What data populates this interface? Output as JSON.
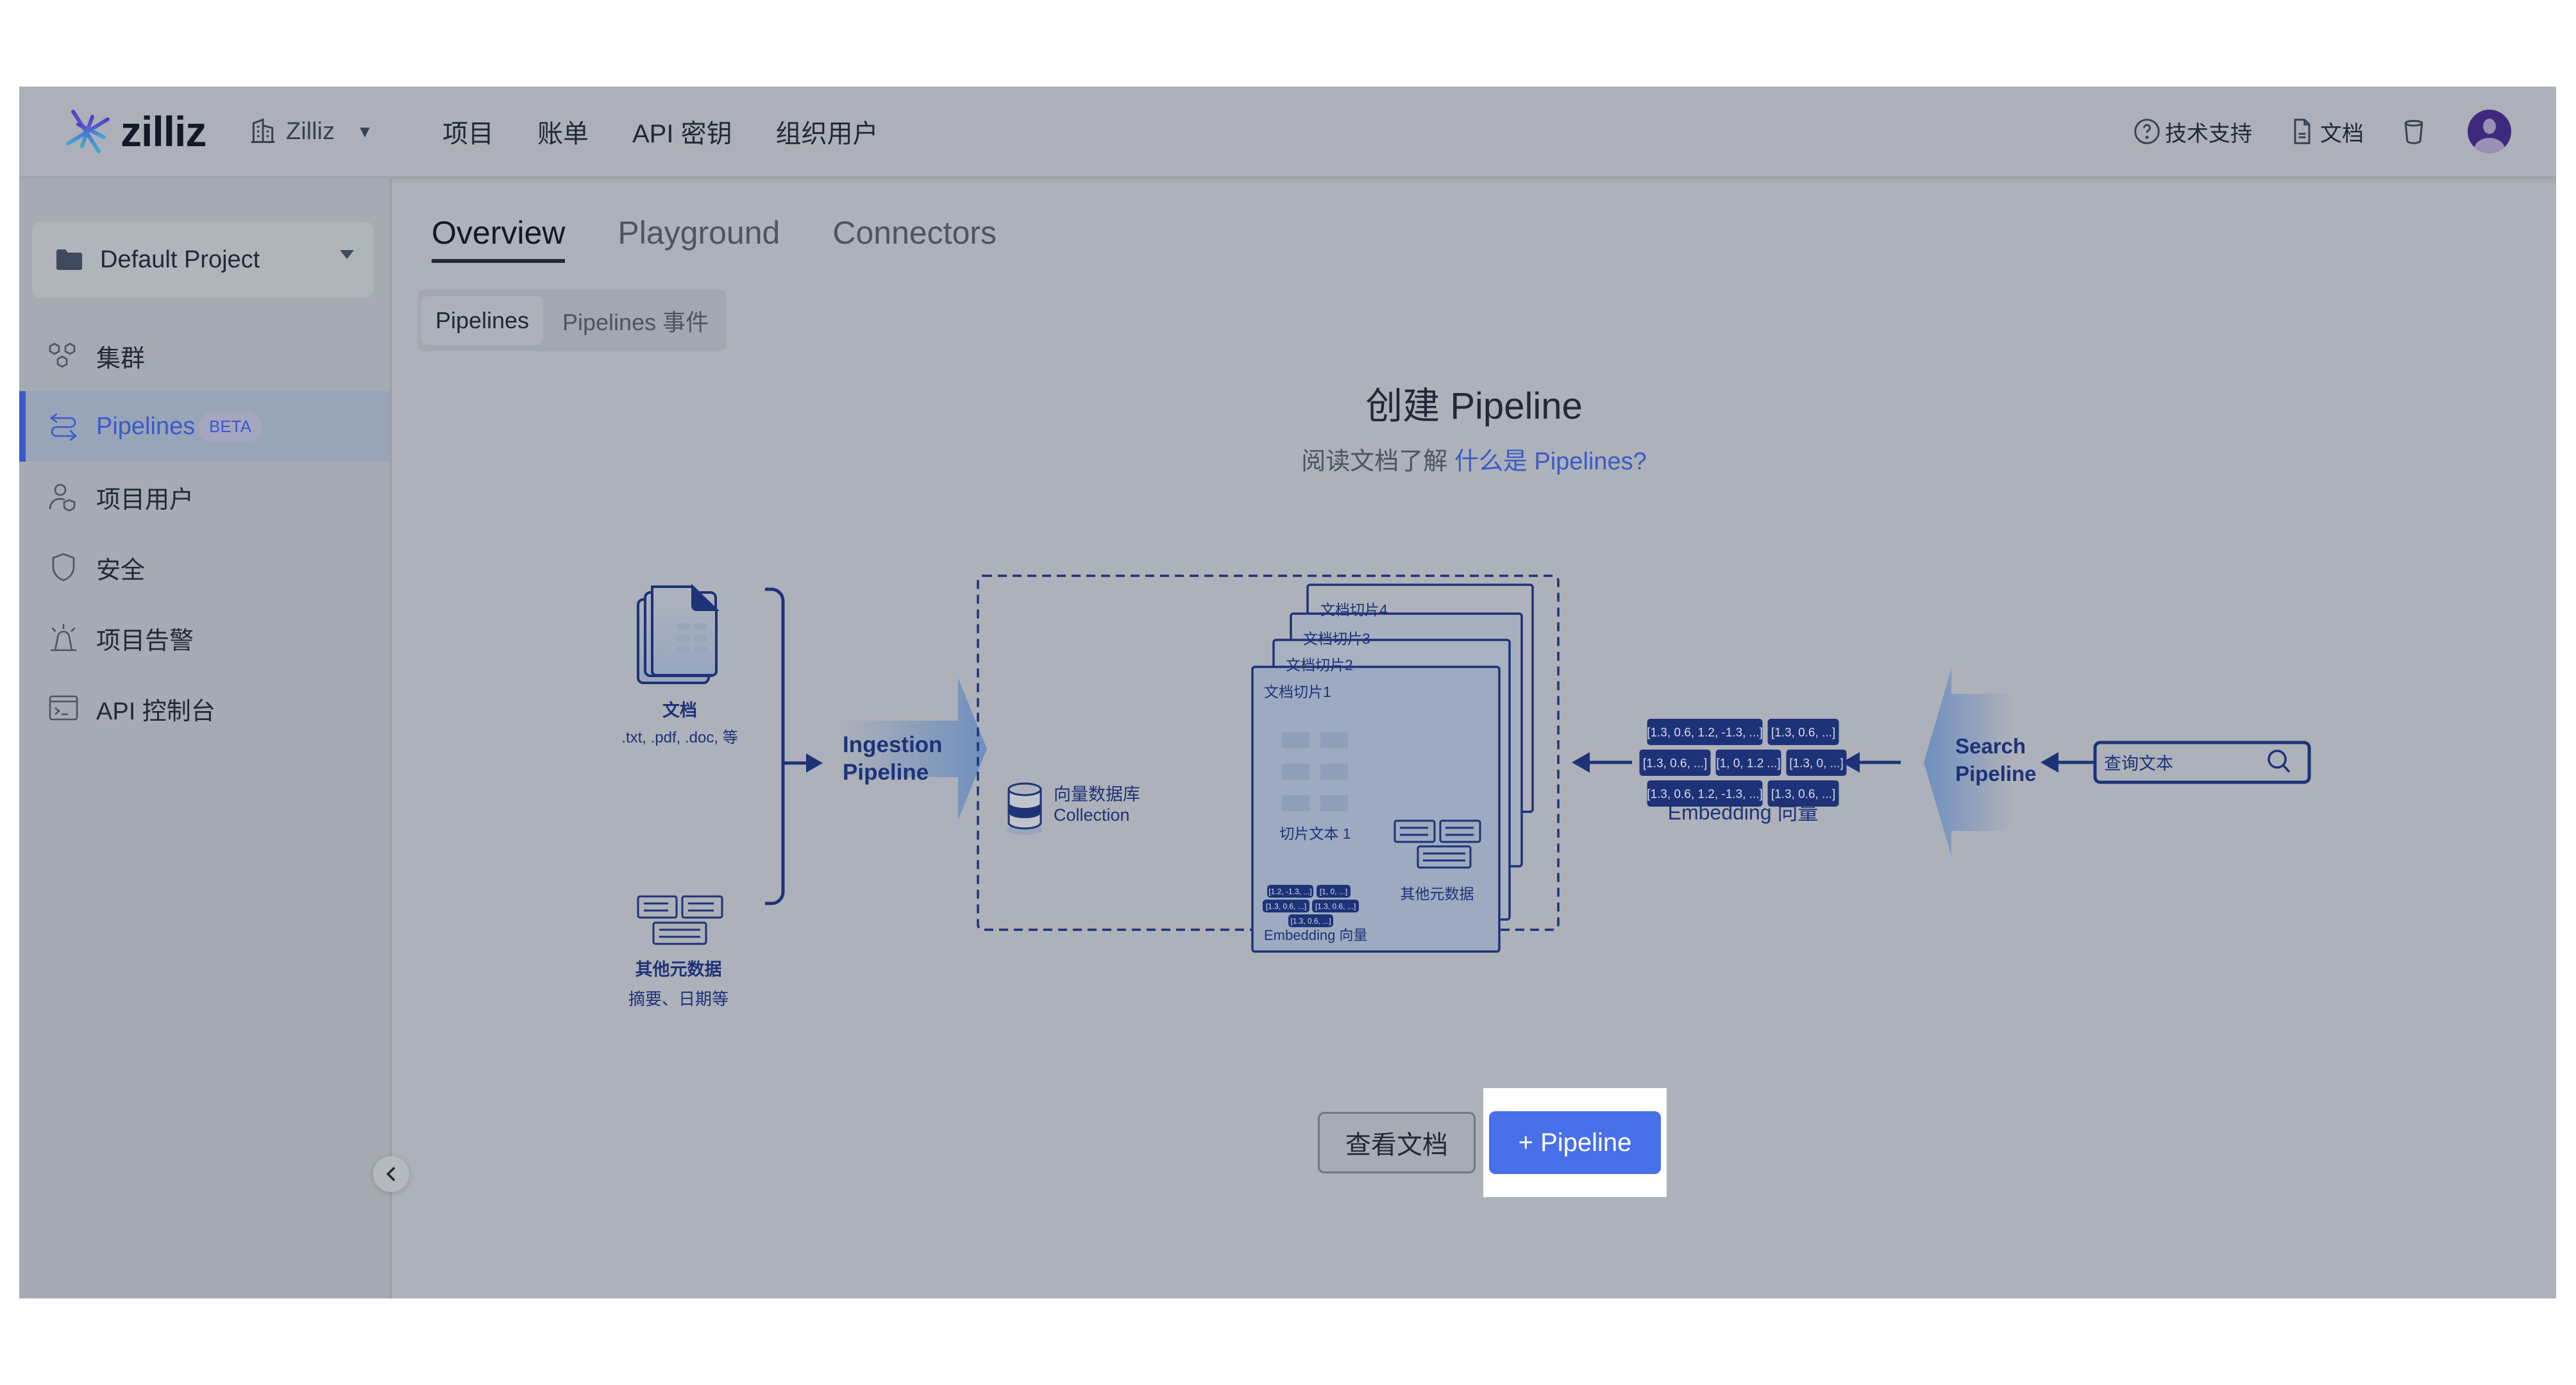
{
  "header": {
    "logo_text": "zilliz",
    "org_name": "Zilliz",
    "nav": [
      "项目",
      "账单",
      "API 密钥",
      "组织用户"
    ],
    "support_label": "技术支持",
    "docs_label": "文档"
  },
  "sidebar": {
    "project": "Default Project",
    "items": [
      {
        "label": "集群",
        "icon": "clusters-icon"
      },
      {
        "label": "Pipelines",
        "icon": "pipelines-icon",
        "badge": "BETA",
        "active": true
      },
      {
        "label": "项目用户",
        "icon": "project-users-icon"
      },
      {
        "label": "安全",
        "icon": "shield-icon"
      },
      {
        "label": "项目告警",
        "icon": "alarm-icon"
      },
      {
        "label": "API 控制台",
        "icon": "terminal-icon"
      }
    ]
  },
  "main": {
    "tabs": [
      "Overview",
      "Playground",
      "Connectors"
    ],
    "active_tab": "Overview",
    "subtabs": [
      "Pipelines",
      "Pipelines 事件"
    ],
    "title": "创建 Pipeline",
    "subtitle_prefix": "阅读文档了解",
    "subtitle_link": "什么是 Pipelines?",
    "buttons": {
      "view_docs": "查看文档",
      "add_pipeline": "+ Pipeline"
    }
  },
  "diagram": {
    "docs_label": "文档",
    "docs_types": ".txt, .pdf, .doc, 等",
    "metadata_label": "其他元数据",
    "metadata_examples": "摘要、日期等",
    "ingestion_label": [
      "Ingestion",
      "Pipeline"
    ],
    "db_label": "向量数据库",
    "db_sub": "Collection",
    "chunks": [
      "文档切片4",
      "文档切片3",
      "文档切片2",
      "文档切片1"
    ],
    "chunk_text": "切片文本 1",
    "chunk_metadata": "其他元数据",
    "chunk_vectors": [
      "[1.2, -1.3, ...]",
      "[1, 0, ...]",
      "[1.3, 0.6, ...]",
      "[1.3, 0.6, ...]",
      "[1.3, 0.6, ...]"
    ],
    "chunk_embedding_label": "Embedding 向量",
    "vectors": [
      [
        "[1.3, 0.6, 1.2, -1.3, ...]",
        "[1.3, 0.6, ...]"
      ],
      [
        "[1.3, 0.6, ...]",
        "[1, 0, 1.2 ...]",
        "[1.3, 0, ...]"
      ],
      [
        "[1.3, 0.6, 1.2, -1.3, ...]",
        "[1.3, 0.6, ...]"
      ]
    ],
    "embedding_label": "Embedding 向量",
    "search_label": [
      "Search",
      "Pipeline"
    ],
    "query_placeholder": "查询文本"
  },
  "colors": {
    "accent": "#3a5bc7",
    "primary_button": "#4870e8",
    "diagram_navy": "#1e3278"
  }
}
